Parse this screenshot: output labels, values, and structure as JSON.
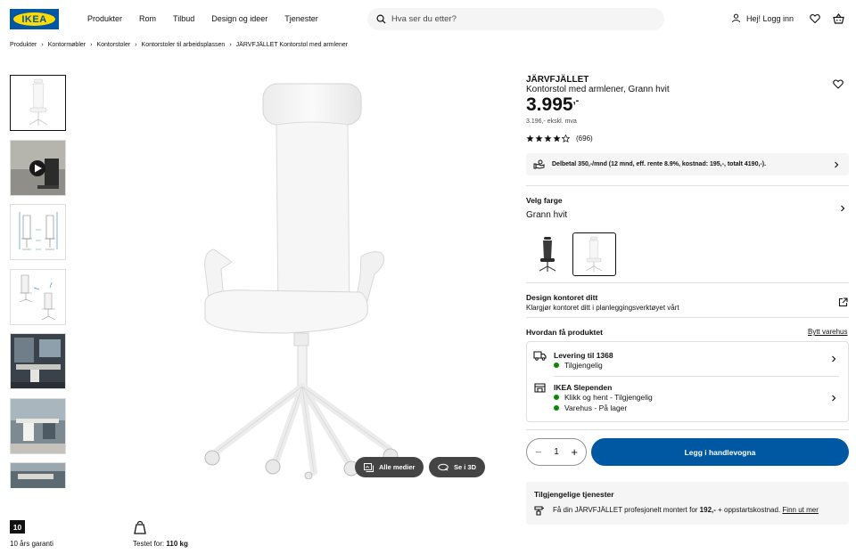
{
  "header": {
    "logo_text": "IKEA",
    "nav": [
      "Produkter",
      "Rom",
      "Tilbud",
      "Design og ideer",
      "Tjenester"
    ],
    "search_placeholder": "Hva ser du etter?",
    "login_label": "Hej! Logg inn"
  },
  "breadcrumbs": [
    "Produkter",
    "Kontormøbler",
    "Kontorstoler",
    "Kontorstoler til arbeidsplassen",
    "JÄRVFJÄLLET Kontorstol med armlener"
  ],
  "media": {
    "all_media_label": "Alle medier",
    "view_3d_label": "Se i 3D"
  },
  "badges": {
    "warranty_number": "10",
    "warranty_label": "10 års garanti",
    "tested_label": "Testet for:",
    "tested_value": "110 kg"
  },
  "product": {
    "name": "JÄRVFJÄLLET",
    "description": "Kontorstol med armlener, Grann hvit",
    "price_main": "3.995",
    "price_suffix": ",-",
    "price_ex_vat": "3.196,- ekskl. mva",
    "rating": 4,
    "rating_count": "(696)",
    "installment": "Delbetal 350,-/mnd (12 mnd, eff. rente 8.9%, kostnad: 195,-, totalt 4190,-)."
  },
  "color": {
    "label": "Velg farge",
    "selected": "Grann hvit"
  },
  "design": {
    "title": "Design kontoret ditt",
    "text": "Klargjør kontoret ditt i planleggingsverktøyet vårt"
  },
  "delivery": {
    "title": "Hvordan få produktet",
    "change_store": "Bytt varehus",
    "ship_title": "Levering til 1368",
    "ship_status": "Tilgjengelig",
    "store_title": "IKEA Slependen",
    "store_status_1": "Klikk og hent - Tilgjengelig",
    "store_status_2": "Varehus - På lager"
  },
  "cart": {
    "quantity": "1",
    "add_label": "Legg i handlevogna"
  },
  "services": {
    "title": "Tilgjengelige tjenester",
    "text_pre": "Få din JÄRVFJÄLLET profesjonelt montert for ",
    "text_price": "192,-",
    "text_post": " + oppstartskostnad. ",
    "link": "Finn ut mer"
  },
  "colors": {
    "brand_blue": "#0058a3",
    "brand_yellow": "#ffdb00",
    "available_green": "#0a8a00"
  }
}
